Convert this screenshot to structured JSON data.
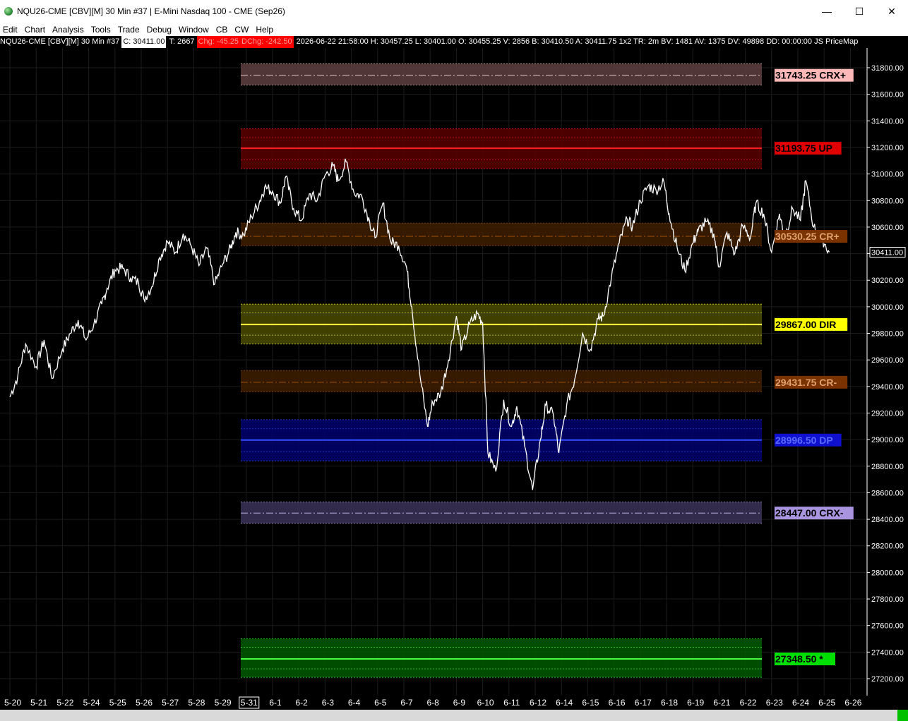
{
  "window": {
    "title": "NQU26-CME [CBV][M]  30 Min  #37 | E-Mini Nasdaq 100 - CME (Sep26)",
    "minimize_glyph": "—",
    "maximize_glyph": "☐",
    "close_glyph": "✕"
  },
  "menu": {
    "items": [
      "Edit",
      "Chart",
      "Analysis",
      "Tools",
      "Trade",
      "Debug",
      "Window",
      "CB",
      "CW",
      "Help"
    ]
  },
  "infobar": {
    "symbol": "NQU26-CME [CBV][M]  30 Min  #37",
    "close": "C: 30411.00",
    "ticks": "T: 2667",
    "chg": "Chg: -45.25",
    "dchg": "DChg: -242.50",
    "rest": "2026-06-22 21:58:00 H: 30457.25 L: 30401.00 O: 30455.25 V: 2856 B: 30410.50 A: 30411.75 1x2 TR: 2m BV: 1481 AV: 1375 DV: 49898 DD: 00:00:00 JS PriceMap"
  },
  "colors": {
    "background": "#000000",
    "grid": "#1c1c1c",
    "price_line": "#ffffff"
  },
  "chart_data": {
    "type": "line",
    "title": "",
    "xlabel": "",
    "ylabel": "",
    "ylim": [
      27100,
      31950
    ],
    "grid": true,
    "y_ticks": [
      27200,
      27400,
      27600,
      27800,
      28000,
      28200,
      28400,
      28600,
      28800,
      29000,
      29200,
      29400,
      29600,
      29800,
      30000,
      30200,
      30400,
      30600,
      30800,
      31000,
      31200,
      31400,
      31600,
      31800
    ],
    "x_categories": [
      "5-20",
      "5-21",
      "5-22",
      "5-24",
      "5-25",
      "5-26",
      "5-27",
      "5-28",
      "5-29",
      "5-31",
      "6-1",
      "6-2",
      "6-3",
      "6-4",
      "6-5",
      "6-7",
      "6-8",
      "6-9",
      "6-10",
      "6-11",
      "6-12",
      "6-14",
      "6-15",
      "6-16",
      "6-17",
      "6-18",
      "6-19",
      "6-21",
      "6-22",
      "6-23",
      "6-24",
      "6-25",
      "6-26"
    ],
    "highlighted_category": "5-31",
    "last_price_label": "30411.00",
    "last_price": 30411,
    "series": [
      {
        "values": [
          [
            0,
            29320
          ],
          [
            0.3,
            29480
          ],
          [
            0.6,
            29720
          ],
          [
            1.0,
            29550
          ],
          [
            1.3,
            29750
          ],
          [
            1.6,
            29460
          ],
          [
            2.0,
            29680
          ],
          [
            2.3,
            29800
          ],
          [
            2.6,
            29900
          ],
          [
            2.9,
            29750
          ],
          [
            3.2,
            29870
          ],
          [
            3.5,
            30020
          ],
          [
            3.7,
            30140
          ],
          [
            4.0,
            30280
          ],
          [
            4.3,
            30290
          ],
          [
            4.6,
            30220
          ],
          [
            4.9,
            30180
          ],
          [
            5.1,
            30060
          ],
          [
            5.4,
            30150
          ],
          [
            5.7,
            30370
          ],
          [
            6.0,
            30490
          ],
          [
            6.3,
            30410
          ],
          [
            6.6,
            30550
          ],
          [
            6.9,
            30460
          ],
          [
            7.2,
            30310
          ],
          [
            7.5,
            30440
          ],
          [
            7.8,
            30170
          ],
          [
            8.1,
            30320
          ],
          [
            8.4,
            30440
          ],
          [
            8.6,
            30560
          ],
          [
            8.9,
            30540
          ],
          [
            9.2,
            30680
          ],
          [
            9.5,
            30790
          ],
          [
            9.7,
            30900
          ],
          [
            10.0,
            30870
          ],
          [
            10.3,
            30780
          ],
          [
            10.5,
            30980
          ],
          [
            10.8,
            30740
          ],
          [
            11.1,
            30650
          ],
          [
            11.4,
            30850
          ],
          [
            11.7,
            30800
          ],
          [
            12.0,
            30990
          ],
          [
            12.3,
            31060
          ],
          [
            12.5,
            30950
          ],
          [
            12.8,
            31090
          ],
          [
            13.1,
            30860
          ],
          [
            13.4,
            30830
          ],
          [
            13.7,
            30640
          ],
          [
            13.9,
            30520
          ],
          [
            14.2,
            30780
          ],
          [
            14.5,
            30490
          ],
          [
            14.8,
            30460
          ],
          [
            15.1,
            30300
          ],
          [
            15.3,
            30000
          ],
          [
            15.6,
            29500
          ],
          [
            15.9,
            29100
          ],
          [
            16.1,
            29280
          ],
          [
            16.4,
            29350
          ],
          [
            16.7,
            29600
          ],
          [
            17.0,
            29930
          ],
          [
            17.2,
            29680
          ],
          [
            17.5,
            29870
          ],
          [
            17.8,
            29950
          ],
          [
            18.0,
            29880
          ],
          [
            18.2,
            28900
          ],
          [
            18.5,
            28760
          ],
          [
            18.8,
            29300
          ],
          [
            19.1,
            29100
          ],
          [
            19.3,
            29250
          ],
          [
            19.6,
            28950
          ],
          [
            19.9,
            28620
          ],
          [
            20.2,
            29000
          ],
          [
            20.4,
            29260
          ],
          [
            20.7,
            29180
          ],
          [
            20.9,
            28900
          ],
          [
            21.2,
            29260
          ],
          [
            21.5,
            29450
          ],
          [
            21.8,
            29800
          ],
          [
            22.1,
            29680
          ],
          [
            22.4,
            29910
          ],
          [
            22.6,
            29930
          ],
          [
            22.9,
            30220
          ],
          [
            23.2,
            30480
          ],
          [
            23.5,
            30660
          ],
          [
            23.7,
            30600
          ],
          [
            24.0,
            30800
          ],
          [
            24.3,
            30910
          ],
          [
            24.6,
            30880
          ],
          [
            24.9,
            30940
          ],
          [
            25.1,
            30700
          ],
          [
            25.4,
            30450
          ],
          [
            25.7,
            30270
          ],
          [
            26.0,
            30480
          ],
          [
            26.2,
            30570
          ],
          [
            26.5,
            30640
          ],
          [
            26.8,
            30550
          ],
          [
            27.0,
            30300
          ],
          [
            27.3,
            30560
          ],
          [
            27.6,
            30400
          ],
          [
            27.9,
            30610
          ],
          [
            28.2,
            30520
          ],
          [
            28.4,
            30780
          ],
          [
            28.7,
            30700
          ],
          [
            29.0,
            30410
          ],
          [
            29.3,
            30700
          ],
          [
            29.5,
            30520
          ],
          [
            29.8,
            30740
          ],
          [
            30.1,
            30650
          ],
          [
            30.3,
            30950
          ],
          [
            30.6,
            30600
          ],
          [
            30.9,
            30520
          ],
          [
            31.2,
            30411
          ]
        ]
      }
    ],
    "levels": [
      {
        "label": "31743.25 CRX+",
        "value": 31743.25,
        "band": [
          31670,
          31830
        ],
        "style": "dashdot",
        "fill": "#5e4040",
        "line": "#e6c3c3",
        "label_bg": "#ffb8b8",
        "label_fg": "#000000"
      },
      {
        "label": "31193.75 UP",
        "value": 31193.75,
        "band": [
          31040,
          31340
        ],
        "style": "solid",
        "fill": "#5a0000",
        "line": "#ff2020",
        "label_bg": "#e00000",
        "label_fg": "#000000"
      },
      {
        "label": "30530.25 CR+",
        "value": 30530.25,
        "band": [
          30460,
          30630
        ],
        "style": "dashdot",
        "fill": "#3f1f00",
        "line": "#a0520d",
        "label_bg": "#7a3300",
        "label_fg": "#e0a070"
      },
      {
        "label": "29867.00 DIR",
        "value": 29867.0,
        "band": [
          29720,
          30020
        ],
        "style": "solid",
        "fill": "#4b4b00",
        "line": "#ffff40",
        "label_bg": "#ffff00",
        "label_fg": "#000000"
      },
      {
        "label": "29431.75 CR-",
        "value": 29431.75,
        "band": [
          29360,
          29520
        ],
        "style": "dashdot",
        "fill": "#3f1f00",
        "line": "#a0520d",
        "label_bg": "#7a3300",
        "label_fg": "#e0a070"
      },
      {
        "label": "28996.50 DP",
        "value": 28996.5,
        "band": [
          28840,
          29150
        ],
        "style": "solid",
        "fill": "#00006e",
        "line": "#3050ff",
        "label_bg": "#1010d0",
        "label_fg": "#5a6aff"
      },
      {
        "label": "28447.00 CRX-",
        "value": 28447.0,
        "band": [
          28370,
          28530
        ],
        "style": "dashdot",
        "fill": "#3b3258",
        "line": "#c0b6ea",
        "label_bg": "#a994e0",
        "label_fg": "#000000"
      },
      {
        "label": "27348.50 *",
        "value": 27348.5,
        "band": [
          27210,
          27500
        ],
        "style": "solid",
        "fill": "#005a00",
        "line": "#40ff40",
        "label_bg": "#00e000",
        "label_fg": "#000000"
      }
    ]
  },
  "status": {
    "indicator": "0"
  }
}
